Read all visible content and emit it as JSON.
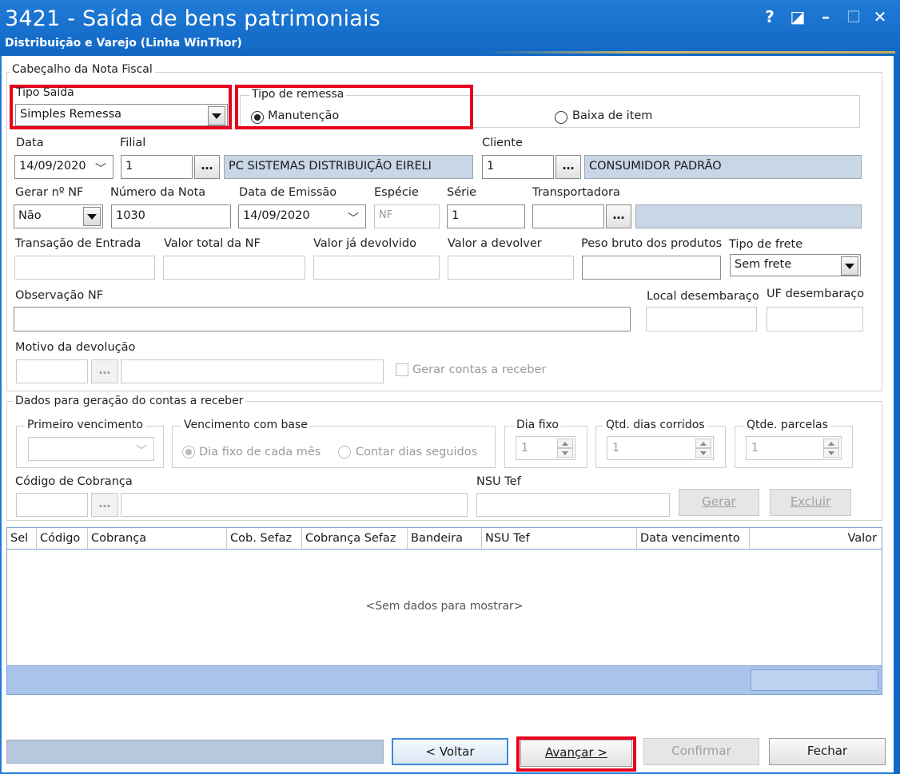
{
  "window": {
    "title": "3421 - Saída de bens patrimoniais",
    "subtitle": "Distribuição e Varejo (Linha WinThor)",
    "controls": [
      "?",
      "◪",
      "–",
      "☐",
      "✕"
    ]
  },
  "header_group": {
    "title": "Cabeçalho da Nota Fiscal",
    "tipo_saida": {
      "label": "Tipo Saída",
      "value": "Simples Remessa"
    },
    "tipo_remessa": {
      "label": "Tipo de remessa",
      "options": [
        {
          "label": "Manutenção",
          "selected": true
        },
        {
          "label": "Baixa de item",
          "selected": false
        }
      ]
    },
    "data": {
      "label": "Data",
      "value": "14/09/2020"
    },
    "filial": {
      "label": "Filial",
      "code": "1",
      "name": "PC SISTEMAS DISTRIBUIÇÃO  EIRELI"
    },
    "cliente": {
      "label": "Cliente",
      "code": "1",
      "name": "CONSUMIDOR PADRÃO"
    },
    "gerar_nf": {
      "label": "Gerar nº NF",
      "value": "Não"
    },
    "numero_nota": {
      "label": "Número da Nota",
      "value": "1030"
    },
    "data_emissao": {
      "label": "Data de Emissão",
      "value": "14/09/2020"
    },
    "especie": {
      "label": "Espécie",
      "value": "NF"
    },
    "serie": {
      "label": "Série",
      "value": "1"
    },
    "transportadora": {
      "label": "Transportadora",
      "code": "",
      "name": ""
    },
    "transacao_entrada": {
      "label": "Transação de Entrada",
      "value": ""
    },
    "valor_total_nf": {
      "label": "Valor total da NF",
      "value": ""
    },
    "valor_ja_devolvido": {
      "label": "Valor já devolvido",
      "value": ""
    },
    "valor_a_devolver": {
      "label": "Valor a devolver",
      "value": ""
    },
    "peso_bruto": {
      "label": "Peso bruto dos produtos",
      "value": ""
    },
    "tipo_frete": {
      "label": "Tipo de frete",
      "value": "Sem frete"
    },
    "observacao_nf": {
      "label": "Observação NF",
      "value": ""
    },
    "local_desembaraco": {
      "label": "Local desembaraço",
      "value": ""
    },
    "uf_desembaraco": {
      "label": "UF desembaraço",
      "value": ""
    },
    "motivo_devolucao": {
      "label": "Motivo da devolução",
      "code": "",
      "name": ""
    },
    "gerar_contas": {
      "label": "Gerar contas a receber",
      "checked": false
    }
  },
  "receivables_group": {
    "title": "Dados para geração do contas a receber",
    "primeiro_vencimento": {
      "label": "Primeiro vencimento",
      "value": ""
    },
    "vencimento_base": {
      "label": "Vencimento com base",
      "options": [
        {
          "label": "Dia fixo de cada mês",
          "selected": true
        },
        {
          "label": "Contar dias seguidos",
          "selected": false
        }
      ]
    },
    "dia_fixo": {
      "label": "Dia fixo",
      "value": "1"
    },
    "qtd_dias_corridos": {
      "label": "Qtd. dias corridos",
      "value": "1"
    },
    "qtde_parcelas": {
      "label": "Qtde. parcelas",
      "value": "1"
    },
    "codigo_cobranca": {
      "label": "Código de Cobrança",
      "code": "",
      "name": ""
    },
    "nsu_tef": {
      "label": "NSU Tef",
      "value": ""
    },
    "gerar_label": "Gerar",
    "excluir_label": "Excluir"
  },
  "grid": {
    "columns": [
      "Sel",
      "Código",
      "Cobrança",
      "Cob. Sefaz",
      "Cobrança Sefaz",
      "Bandeira",
      "NSU Tef",
      "Data vencimento",
      "Valor"
    ],
    "empty_text": "<Sem dados para mostrar>"
  },
  "footer": {
    "status": "",
    "voltar_label": "< Voltar",
    "avancar_label": "Avançar >",
    "confirmar_label": "Confirmar",
    "fechar_label": "Fechar"
  },
  "colors": {
    "titlebar": "#1167c4",
    "highlight": "#e8001c",
    "grid_header_border": "#7ea2d6",
    "grid_footer": "#a9c3ea",
    "readonly_field": "#c9d6e6"
  }
}
